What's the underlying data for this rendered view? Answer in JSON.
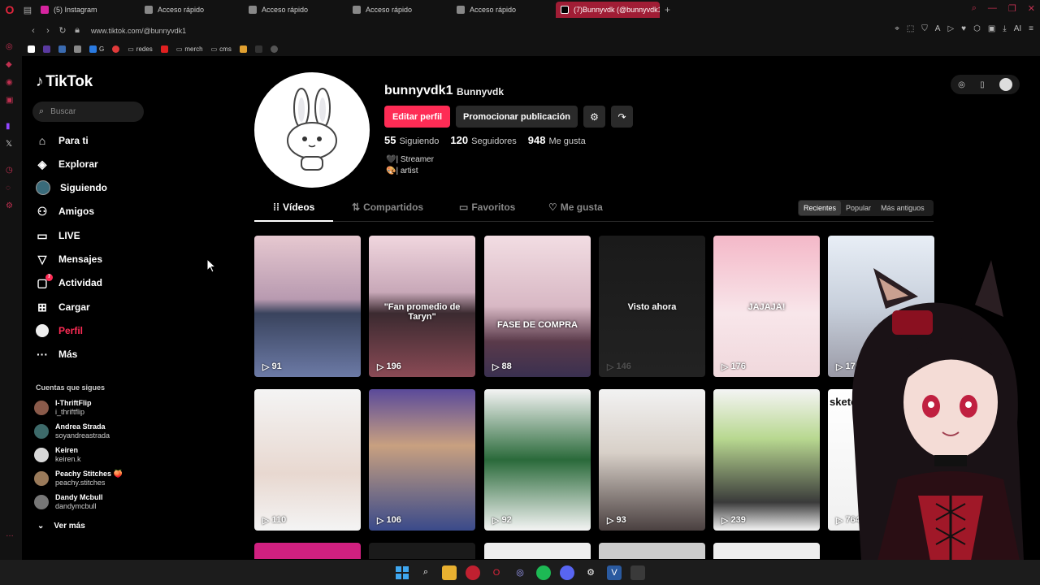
{
  "browser": {
    "tabs": [
      {
        "label": "(5) Instagram",
        "color": "#d6249f",
        "active": false
      },
      {
        "label": "Acceso rápido",
        "color": "#888888",
        "active": false
      },
      {
        "label": "Acceso rápido",
        "color": "#888888",
        "active": false
      },
      {
        "label": "Acceso rápido",
        "color": "#888888",
        "active": false
      },
      {
        "label": "Acceso rápido",
        "color": "#888888",
        "active": false
      },
      {
        "label": "(7)Bunnyvdk (@bunnyvdk1",
        "color": "#000000",
        "active": true
      }
    ],
    "url": "www.tiktok.com/@bunnyvdk1",
    "bookmarks": [
      "G",
      "redes",
      "merch",
      "cms"
    ]
  },
  "tiktok": {
    "logo": "TikTok",
    "search_placeholder": "Buscar",
    "nav": [
      {
        "label": "Para ti",
        "icon": "home-icon"
      },
      {
        "label": "Explorar",
        "icon": "compass-icon"
      },
      {
        "label": "Siguiendo",
        "icon": "following-avatar"
      },
      {
        "label": "Amigos",
        "icon": "friends-icon"
      },
      {
        "label": "LIVE",
        "icon": "live-icon"
      },
      {
        "label": "Mensajes",
        "icon": "messages-icon"
      },
      {
        "label": "Actividad",
        "icon": "activity-icon",
        "badge": "7"
      },
      {
        "label": "Cargar",
        "icon": "upload-icon"
      },
      {
        "label": "Perfil",
        "icon": "profile-icon",
        "active": true
      },
      {
        "label": "Más",
        "icon": "more-icon"
      }
    ],
    "follows_title": "Cuentas que sigues",
    "following": [
      {
        "name": "I-ThriftFlip",
        "user": "i_thriftflip",
        "color": "#8a5a4a"
      },
      {
        "name": "Andrea Strada",
        "user": "soyandreastrada",
        "color": "#3d6a6a"
      },
      {
        "name": "Keiren",
        "user": "keiren.k",
        "color": "#d8d8d8"
      },
      {
        "name": "Peachy Stitches 🍑",
        "user": "peachy.stitches",
        "color": "#9a7a5a"
      },
      {
        "name": "Dandy Mcbull",
        "user": "dandymcbull",
        "color": "#777777"
      }
    ],
    "see_more": "Ver más"
  },
  "profile": {
    "username": "bunnyvdk1",
    "nickname": "Bunnyvdk",
    "edit_label": "Editar perfil",
    "promote_label": "Promocionar publicación",
    "stats": [
      {
        "value": "55",
        "label": "Siguiendo"
      },
      {
        "value": "120",
        "label": "Seguidores"
      },
      {
        "value": "948",
        "label": "Me gusta"
      }
    ],
    "bio": [
      "🖤| Streamer",
      "🎨| artist"
    ]
  },
  "content_tabs": [
    {
      "label": "Vídeos",
      "icon": "grid-icon",
      "active": true
    },
    {
      "label": "Compartidos",
      "icon": "repost-icon"
    },
    {
      "label": "Favoritos",
      "icon": "bookmark-icon"
    },
    {
      "label": "Me gusta",
      "icon": "heart-icon"
    }
  ],
  "sort_options": [
    "Recientes",
    "Popular",
    "Más antiguos"
  ],
  "videos": [
    {
      "views": "91",
      "overlay": "",
      "bg": "linear-gradient(180deg,#e6c8d0 0%,#b89ab0 45%,#39435d 55%,#6c7aa6 100%)"
    },
    {
      "views": "196",
      "overlay": "\"Fan promedio de Taryn\"",
      "bg": "linear-gradient(180deg,#f0d6de 0%,#c8a8b8 40%,#3b2a30 55%,#8a4a55 100%)"
    },
    {
      "views": "88",
      "overlay": "FASE DE COMPRA",
      "bg": "linear-gradient(180deg,#f2dde3 0%,#d8b8c4 50%,#5a3a4a 75%,#3a3050 100%)"
    },
    {
      "views": "146",
      "overlay": "Visto ahora",
      "bg": "linear-gradient(180deg,#1a1a1a 0%,#222 100%)"
    },
    {
      "views": "176",
      "overlay": "JAJAJA!",
      "bg": "linear-gradient(180deg,#f4b8c8 0%,#f8e6ea 55%,#f0d8dc 100%)"
    },
    {
      "views": "176",
      "overlay": "",
      "bg": "linear-gradient(180deg,#e8eef6 0%,#c8d0dc 50%,#9a9aa6 100%)"
    },
    {
      "views": "110",
      "overlay": "",
      "bg": "linear-gradient(180deg,#f4f4f4 0%,#e8d8d0 60%,#f4f4f4 100%)"
    },
    {
      "views": "106",
      "overlay": "",
      "bg": "linear-gradient(180deg,#5a4a9a 0%,#c8a080 40%,#3a4a8a 100%)"
    },
    {
      "views": "92",
      "overlay": "",
      "bg": "linear-gradient(180deg,#f4f4f4 0%,#2a6a3a 50%,#f4f4f4 100%)"
    },
    {
      "views": "93",
      "overlay": "",
      "bg": "linear-gradient(180deg,#f2f2f2 0%,#d8d0c8 45%,#4a4040 100%)"
    },
    {
      "views": "239",
      "overlay": "",
      "bg": "linear-gradient(180deg,#f4f4f4 0%,#b8d890 35%,#3a3a3a 80%,#f4f4f4 100%)"
    },
    {
      "views": "764",
      "overlay": "sketch",
      "bg": "linear-gradient(180deg,#ffffff 0%,#f0f0f0 100%)"
    }
  ],
  "colors": {
    "accent": "#fe2c55",
    "bg": "#000000"
  }
}
